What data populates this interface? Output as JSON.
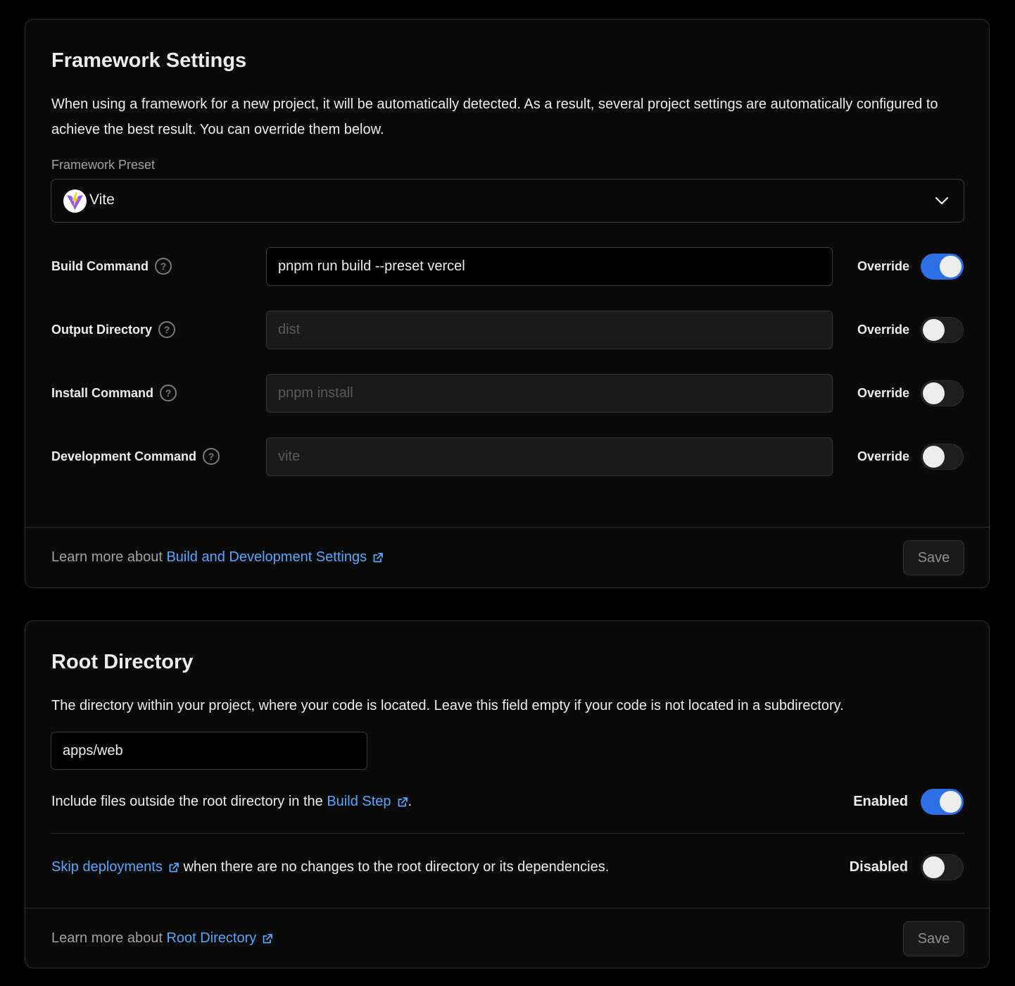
{
  "framework": {
    "title": "Framework Settings",
    "description": "When using a framework for a new project, it will be automatically detected. As a result, several project settings are automatically configured to achieve the best result. You can override them below.",
    "preset_label": "Framework Preset",
    "preset_value": "Vite",
    "preset_icon": "vite-logo-icon",
    "rows": [
      {
        "label": "Build Command",
        "value": "pnpm run build --preset vercel",
        "override_label": "Override",
        "override": true
      },
      {
        "label": "Output Directory",
        "value": "dist",
        "override_label": "Override",
        "override": false
      },
      {
        "label": "Install Command",
        "value": "pnpm install",
        "override_label": "Override",
        "override": false
      },
      {
        "label": "Development Command",
        "value": "vite",
        "override_label": "Override",
        "override": false
      }
    ],
    "help_glyph": "?",
    "footer_prefix": "Learn more about",
    "footer_link": "Build and Development Settings",
    "save_label": "Save"
  },
  "root": {
    "title": "Root Directory",
    "description": "The directory within your project, where your code is located. Leave this field empty if your code is not located in a subdirectory.",
    "value": "apps/web",
    "include_prefix": "Include files outside the root directory in the",
    "include_link": "Build Step",
    "include_suffix": ".",
    "include_status": "Enabled",
    "include_on": true,
    "skip_link": "Skip deployments",
    "skip_suffix": "when there are no changes to the root directory or its dependencies.",
    "skip_status": "Disabled",
    "skip_on": false,
    "footer_prefix": "Learn more about",
    "footer_link": "Root Directory",
    "save_label": "Save"
  },
  "colors": {
    "accent": "#2e6fe6",
    "link": "#52a8ff",
    "background": "#000000",
    "card": "#0a0a0a"
  }
}
